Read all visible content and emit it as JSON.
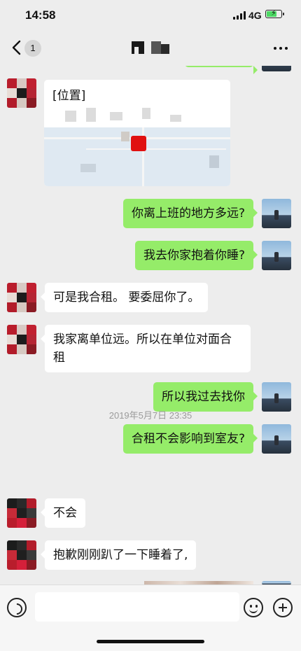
{
  "status": {
    "time": "14:58",
    "network": "4G"
  },
  "nav": {
    "unread_count": "1"
  },
  "location_message": {
    "label": "[位置]"
  },
  "messages": [
    {
      "side": "right",
      "text": "你离上班的地方多远?"
    },
    {
      "side": "right",
      "text": "我去你家抱着你睡?"
    },
    {
      "side": "left",
      "text": "可是我合租。 要委屈你了。"
    },
    {
      "side": "left",
      "text": "我家离单位远。所以在单位对面合租"
    },
    {
      "side": "right",
      "text": "所以我过去找你"
    },
    {
      "side": "right",
      "text": "合租不会影响到室友?"
    },
    {
      "side": "left",
      "text": "不会"
    },
    {
      "side": "left",
      "text": "抱歉刚刚趴了一下睡着了,"
    }
  ],
  "timestamp": "2019年5月7日 23:35",
  "colors": {
    "sent_bubble": "#95ec69",
    "received_bubble": "#ffffff",
    "chat_bg": "#ededed"
  },
  "icons": [
    "back-chevron-icon",
    "more-dots-icon",
    "voice-icon",
    "emoji-icon",
    "plus-icon"
  ]
}
